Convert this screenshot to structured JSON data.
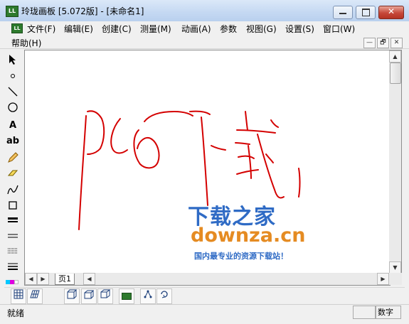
{
  "window": {
    "title": "玲珑画板 [5.072版] - [未命名1]",
    "app_icon_text": "LL",
    "minimize_glyph": "—",
    "maximize_glyph": "□",
    "close_glyph": "✕"
  },
  "menu": {
    "items": [
      "文件(F)",
      "编辑(E)",
      "创建(C)",
      "测量(M)",
      "动画(A)",
      "参数",
      "视图(G)",
      "设置(S)",
      "窗口(W)"
    ],
    "help": "帮助(H)"
  },
  "mdi_buttons": [
    "—",
    "🗗",
    "✕"
  ],
  "tools": {
    "text_tool": "A",
    "label_tool": "ab"
  },
  "tab": {
    "label": "页1"
  },
  "status": {
    "left": "就绪",
    "right": "数字"
  },
  "watermark": {
    "title": "下载之家",
    "url": "downza.cn",
    "tagline": "国内最专业的资源下载站！"
  },
  "colors": {
    "ink": "#d40000",
    "watermark_blue": "#2f6bc5",
    "watermark_orange": "#e58b22"
  }
}
